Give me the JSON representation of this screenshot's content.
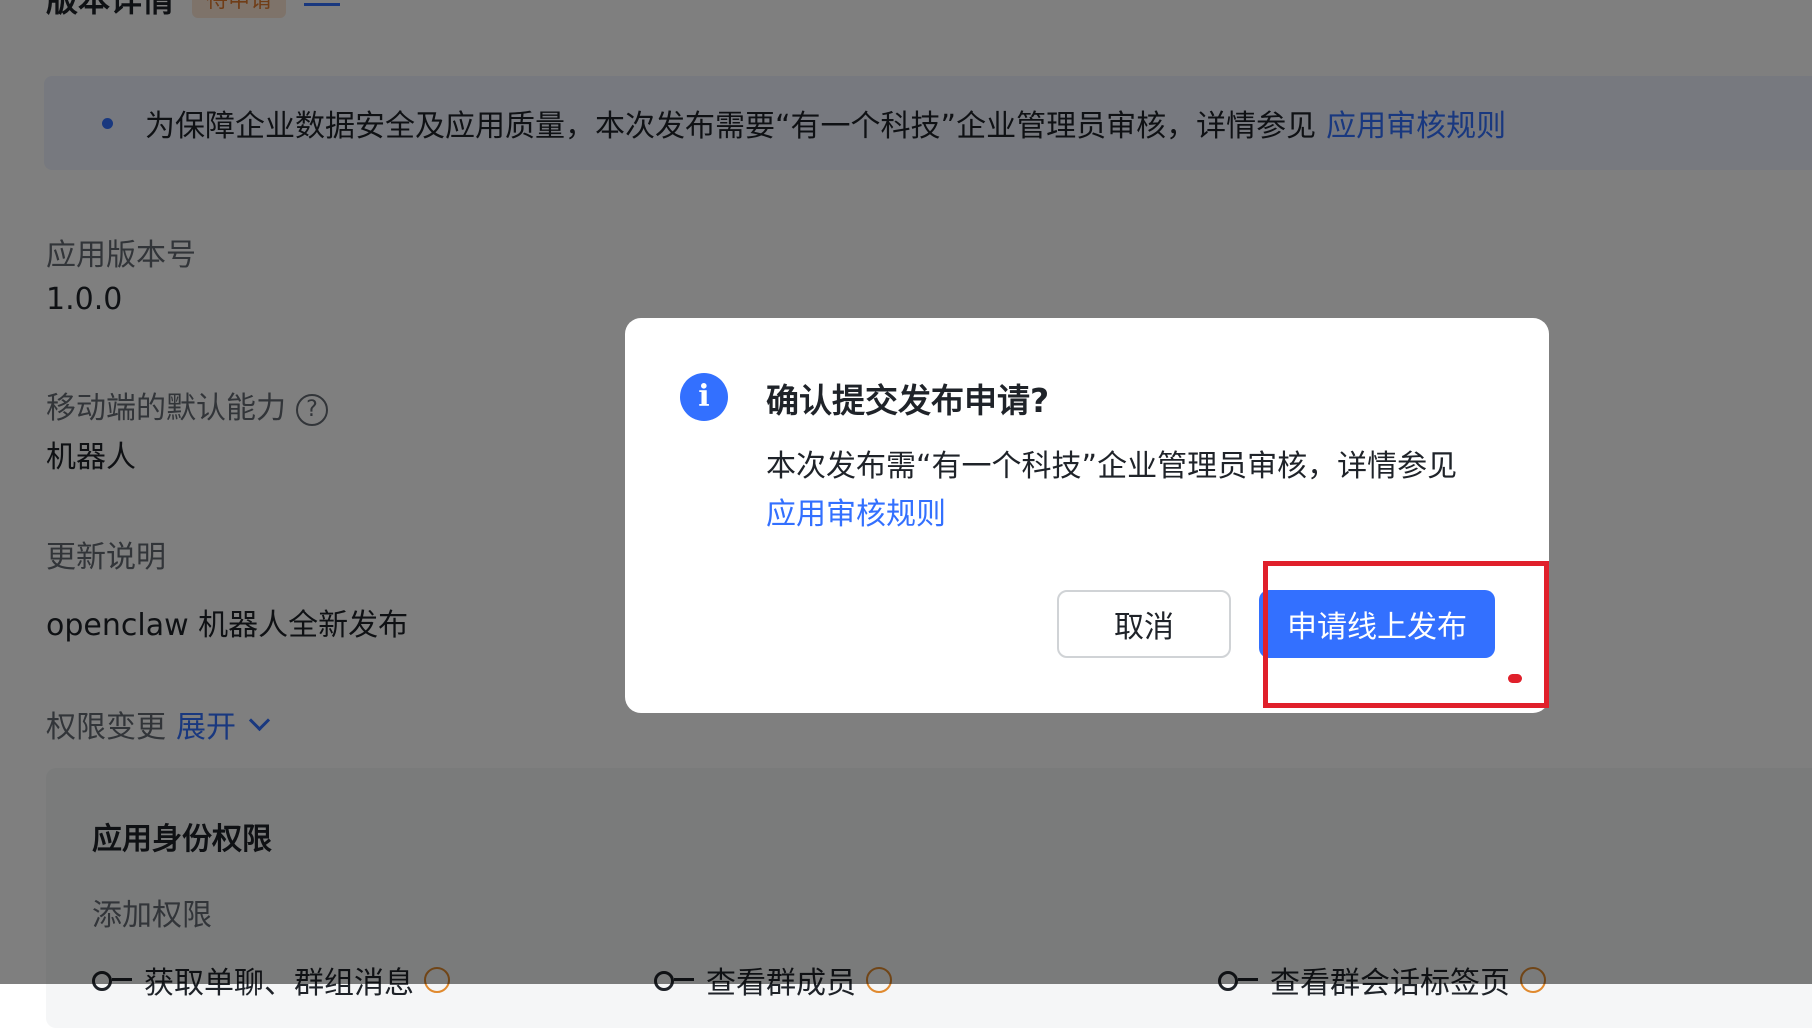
{
  "page": {
    "title": "版本详情",
    "status_tag": "待申请"
  },
  "notice": {
    "text": "为保障企业数据安全及应用质量，本次发布需要“有一个科技”企业管理员审核，详情参见",
    "link": "应用审核规则"
  },
  "fields": {
    "version_label": "应用版本号",
    "version_value": "1.0.0",
    "mobile_label": "移动端的默认能力",
    "mobile_help": "?",
    "mobile_value": "机器人",
    "notes_label": "更新说明",
    "notes_value": "openclaw 机器人全新发布"
  },
  "permissions": {
    "label": "权限变更",
    "expand": "展开",
    "panel_title": "应用身份权限",
    "panel_subtitle": "添加权限",
    "items": [
      {
        "label": "获取单聊、群组消息",
        "icon": "key-icon",
        "warn": "warning-icon"
      },
      {
        "label": "查看群成员",
        "icon": "key-icon",
        "warn": "warning-icon"
      },
      {
        "label": "查看群会话标签页",
        "icon": "key-icon",
        "warn": "warning-icon"
      }
    ]
  },
  "modal": {
    "icon": "i",
    "title": "确认提交发布申请?",
    "body": "本次发布需“有一个科技”企业管理员审核，详情参见",
    "link": "应用审核规则",
    "cancel_label": "取消",
    "confirm_label": "申请线上发布"
  },
  "colors": {
    "accent": "#3370ff",
    "highlight": "#e0202b",
    "overlay": "rgba(0,0,0,0.5)"
  }
}
